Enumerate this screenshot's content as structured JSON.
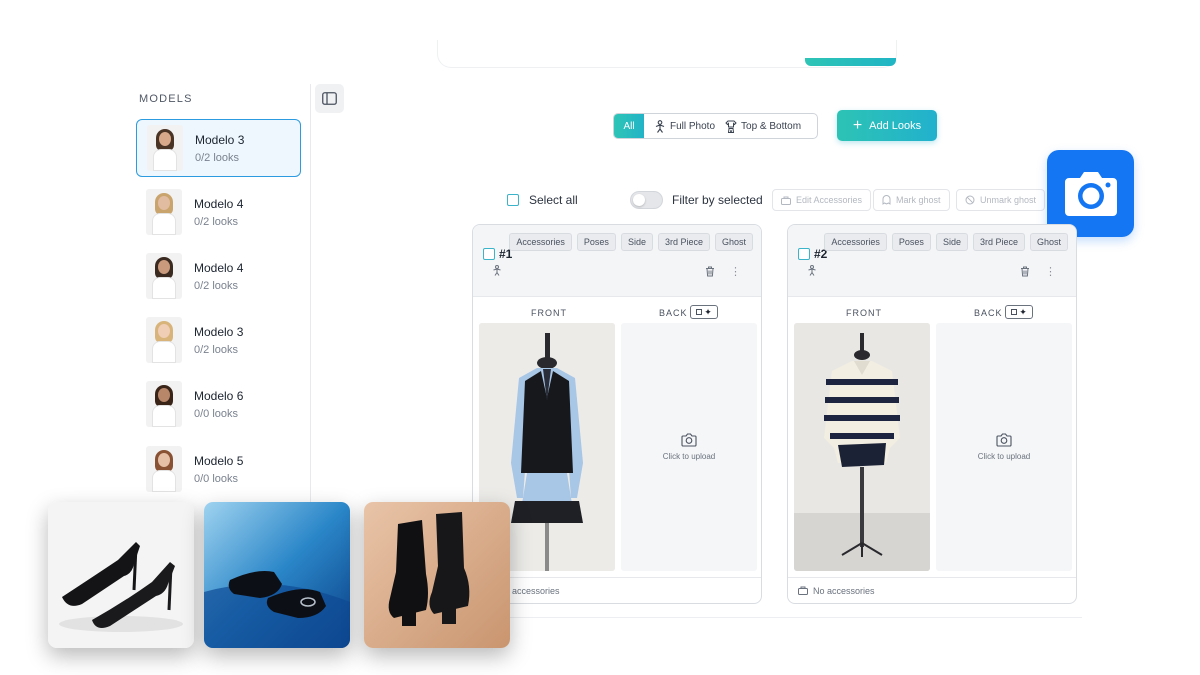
{
  "sidebar": {
    "title": "MODELS",
    "models": [
      {
        "name": "Modelo 3",
        "looks": "0/2 looks",
        "skin": "#d7a98a",
        "hair": "#4a3426"
      },
      {
        "name": "Modelo 4",
        "looks": "0/2 looks",
        "skin": "#e2bca0",
        "hair": "#c9a46c"
      },
      {
        "name": "Modelo 4",
        "looks": "0/2 looks",
        "skin": "#c99a7c",
        "hair": "#3a2a20"
      },
      {
        "name": "Modelo 3",
        "looks": "0/2 looks",
        "skin": "#f0cdb5",
        "hair": "#d8b47a"
      },
      {
        "name": "Modelo 6",
        "looks": "0/0 looks",
        "skin": "#b8876a",
        "hair": "#3a2418"
      },
      {
        "name": "Modelo 5",
        "looks": "0/0 looks",
        "skin": "#e6c0a6",
        "hair": "#8a5234"
      }
    ]
  },
  "filters": {
    "all": "All",
    "full_photo": "Full Photo",
    "top_bottom": "Top & Bottom",
    "add_looks": "Add Looks"
  },
  "toolbar": {
    "select_all": "Select all",
    "filter_by_selected": "Filter by selected",
    "edit_accessories": "Edit Accessories",
    "mark_ghost": "Mark ghost",
    "unmark_ghost": "Unmark ghost"
  },
  "cards": [
    {
      "number": "#1",
      "tags": [
        "Accessories",
        "Poses",
        "Side",
        "3rd Piece",
        "Ghost"
      ],
      "front_label": "FRONT",
      "back_label": "BACK",
      "upload_text": "Click to upload",
      "footer": "No accessories"
    },
    {
      "number": "#2",
      "tags": [
        "Accessories",
        "Poses",
        "Side",
        "3rd Piece",
        "Ghost"
      ],
      "front_label": "FRONT",
      "back_label": "BACK",
      "upload_text": "Click to upload",
      "footer": "No accessories"
    }
  ],
  "colors": {
    "accent": "#2ec4b6",
    "active_border": "#2d9be0",
    "camera_badge": "#1476f2"
  }
}
